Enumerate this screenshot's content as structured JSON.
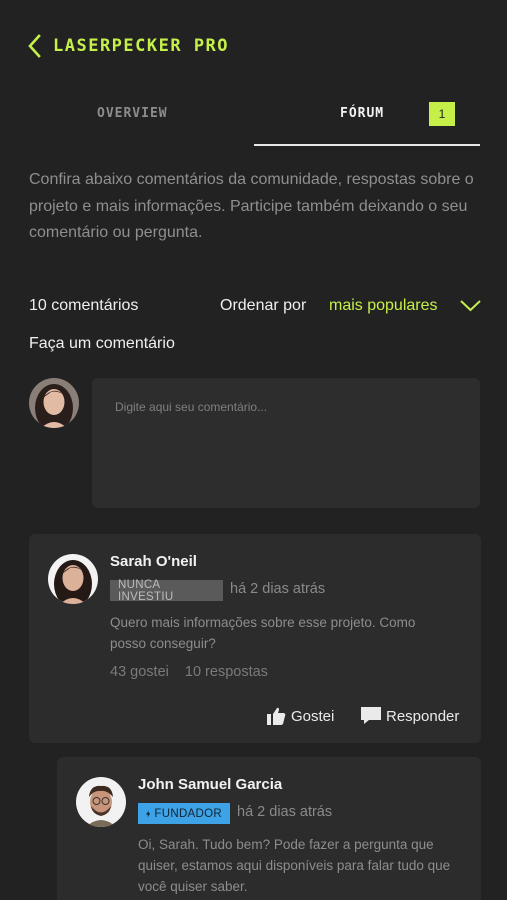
{
  "header": {
    "title": "LASERPECKER PRO"
  },
  "tabs": [
    {
      "label": "OVERVIEW"
    },
    {
      "label": "FÓRUM",
      "badge": "1"
    }
  ],
  "intro": "Confira abaixo comentários da comunidade, respostas sobre o projeto e mais informações. Participe também deixando o seu comentário ou pergunta.",
  "comments_bar": {
    "count_label": "10 comentários",
    "sort_label": "Ordenar por",
    "sort_value": "mais populares"
  },
  "new_comment": {
    "heading": "Faça um comentário",
    "placeholder": "Digite aqui seu comentário..."
  },
  "comments": [
    {
      "author": "Sarah O'neil",
      "badge": "NUNCA INVESTIU",
      "time": "há 2 dias atrás",
      "text": "Quero mais informações sobre esse projeto. Como posso conseguir?",
      "likes": "43 gostei",
      "replies": "10 respostas",
      "like_label": "Gostei",
      "reply_label": "Responder"
    },
    {
      "author": "John Samuel Garcia",
      "badge": "FUNDADOR",
      "time": "há 2 dias atrás",
      "text": "Oi, Sarah. Tudo bem? Pode fazer a pergunta que quiser, estamos aqui disponíveis para falar tudo que você quiser saber."
    }
  ],
  "colors": {
    "background": "#222222",
    "accent": "#c5f04a",
    "card": "#2c2c2c",
    "founder_badge": "#3ea3e6"
  },
  "icons": [
    "chevron-left-icon",
    "chevron-down-icon",
    "thumbs-up-icon",
    "speech-bubble-icon",
    "lightning-bolt-icon"
  ]
}
